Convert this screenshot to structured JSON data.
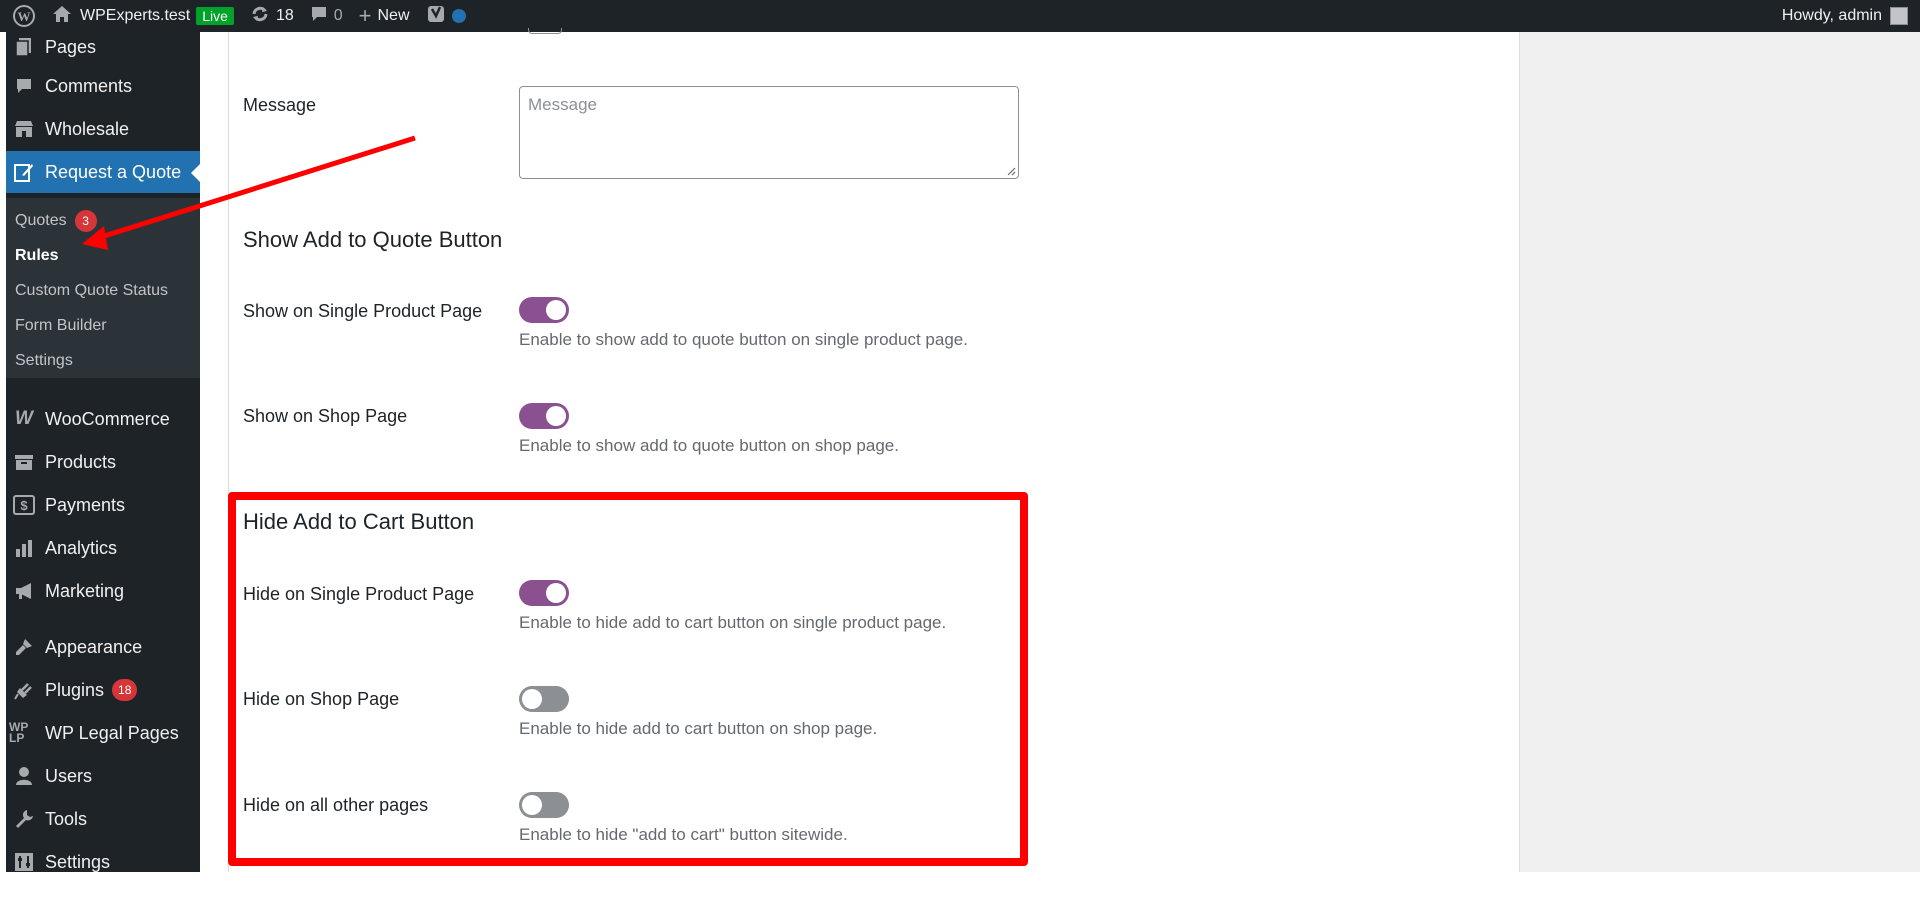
{
  "admin_bar": {
    "site_name": "WPExperts.test",
    "live_label": "Live",
    "updates_count": "18",
    "comments_count": "0",
    "new_label": "New",
    "greeting": "Howdy, admin"
  },
  "sidebar": {
    "items": [
      {
        "label": "Pages",
        "icon": "pages-icon"
      },
      {
        "label": "Comments",
        "icon": "comments-icon"
      },
      {
        "label": "Wholesale",
        "icon": "store-icon"
      },
      {
        "label": "Request a Quote",
        "icon": "edit-icon"
      },
      {
        "label": "WooCommerce",
        "icon": "woocommerce-icon"
      },
      {
        "label": "Products",
        "icon": "archive-icon"
      },
      {
        "label": "Payments",
        "icon": "payments-icon"
      },
      {
        "label": "Analytics",
        "icon": "bar-chart-icon"
      },
      {
        "label": "Marketing",
        "icon": "megaphone-icon"
      },
      {
        "label": "Appearance",
        "icon": "brush-icon"
      },
      {
        "label": "Plugins",
        "icon": "plugin-icon",
        "badge": "18"
      },
      {
        "label": "WP Legal Pages",
        "icon": "wplp-icon",
        "icon_text": "WP LP"
      },
      {
        "label": "Users",
        "icon": "user-icon"
      },
      {
        "label": "Tools",
        "icon": "wrench-icon"
      },
      {
        "label": "Settings",
        "icon": "settings-icon"
      }
    ],
    "submenu": [
      {
        "label": "Quotes",
        "badge": "3"
      },
      {
        "label": "Rules"
      },
      {
        "label": "Custom Quote Status"
      },
      {
        "label": "Form Builder"
      },
      {
        "label": "Settings"
      }
    ]
  },
  "form": {
    "message_label": "Message",
    "message_placeholder": "Message",
    "show_section_title": "Show Add to Quote Button",
    "show_single_label": "Show on Single Product Page",
    "show_single_desc": "Enable to show add to quote button on single product page.",
    "show_single_on": true,
    "show_shop_label": "Show on Shop Page",
    "show_shop_desc": "Enable to show add to quote button on shop page.",
    "show_shop_on": true,
    "hide_section_title": "Hide Add to Cart Button",
    "hide_single_label": "Hide on Single Product Page",
    "hide_single_desc": "Enable to hide add to cart button on single product page.",
    "hide_single_on": true,
    "hide_shop_label": "Hide on Shop Page",
    "hide_shop_desc": "Enable to hide add to cart button on shop page.",
    "hide_shop_on": false,
    "hide_all_label": "Hide on all other pages",
    "hide_all_desc": "Enable to hide \"add to cart\" button sitewide.",
    "hide_all_on": false
  },
  "colors": {
    "annotation": "#ff0000",
    "toggle_on": "#8b5090",
    "menu_current": "#2271b1"
  }
}
